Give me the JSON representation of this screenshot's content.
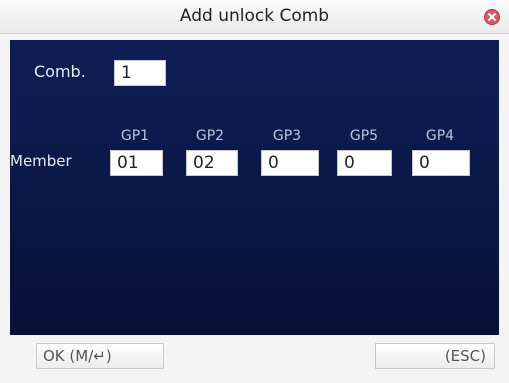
{
  "window": {
    "title": "Add unlock Comb",
    "close_icon": "close-icon"
  },
  "form": {
    "comb_label": "Comb.",
    "comb_value": "1",
    "member_label": "Member",
    "groups": [
      {
        "header": "GP1",
        "value": "01"
      },
      {
        "header": "GP2",
        "value": "02"
      },
      {
        "header": "GP3",
        "value": "0"
      },
      {
        "header": "GP5",
        "value": "0"
      },
      {
        "header": "GP4",
        "value": "0"
      }
    ]
  },
  "buttons": {
    "ok": "OK (M/↵)",
    "esc": "(ESC)"
  },
  "colors": {
    "panel_background": "#0c1a4d",
    "close_icon": "#d65a6a"
  }
}
